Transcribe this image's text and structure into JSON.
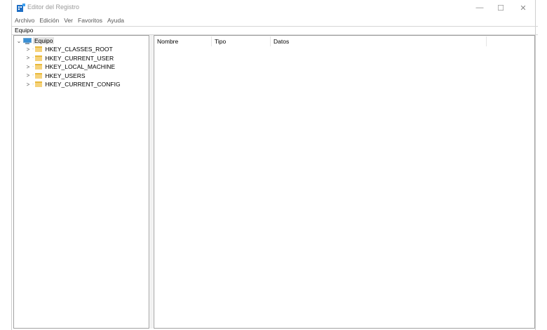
{
  "window": {
    "title": "Editor del Registro",
    "controls": {
      "minimize": "—",
      "maximize": "☐",
      "close": "✕"
    }
  },
  "menu": [
    "Archivo",
    "Edición",
    "Ver",
    "Favoritos",
    "Ayuda"
  ],
  "address": "Equipo",
  "tree": {
    "root": {
      "label": "Equipo",
      "expander": "⌄"
    },
    "children": [
      {
        "label": "HKEY_CLASSES_ROOT",
        "expander": ">"
      },
      {
        "label": "HKEY_CURRENT_USER",
        "expander": ">"
      },
      {
        "label": "HKEY_LOCAL_MACHINE",
        "expander": ">"
      },
      {
        "label": "HKEY_USERS",
        "expander": ">"
      },
      {
        "label": "HKEY_CURRENT_CONFIG",
        "expander": ">"
      }
    ]
  },
  "list": {
    "columns": [
      "Nombre",
      "Tipo",
      "Datos"
    ]
  }
}
